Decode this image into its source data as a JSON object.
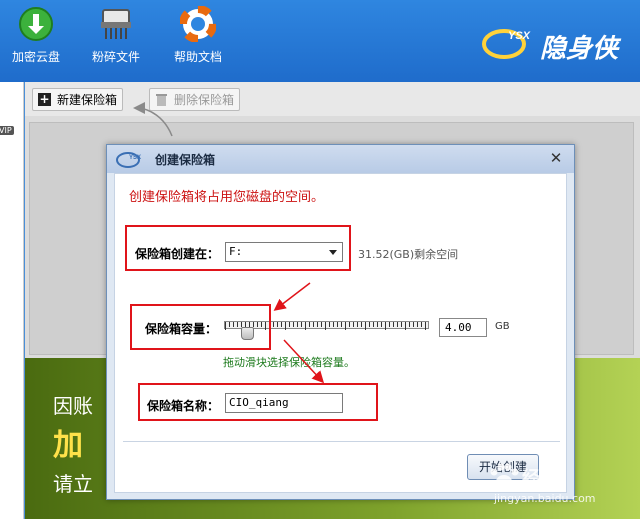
{
  "toolbar": {
    "tools": [
      {
        "label": "加密云盘",
        "icon": "cloud-icon"
      },
      {
        "label": "粉碎文件",
        "icon": "shredder-icon"
      },
      {
        "label": "帮助文档",
        "icon": "lifebuoy-icon"
      }
    ],
    "brand_text": "隐身侠"
  },
  "sidebar": {
    "vip_tag": "VIP"
  },
  "main_toolbar": {
    "new_label": "新建保险箱",
    "delete_label": "删除保险箱"
  },
  "banner": {
    "line1": "因账",
    "line2": "加",
    "line3": "请立"
  },
  "dialog": {
    "title": "创建保险箱",
    "notice": "创建保险箱将占用您磁盘的空间。",
    "location_label": "保险箱创建在：",
    "drive_value": "F:",
    "free_space": "31.52(GB)剩余空间",
    "capacity_label": "保险箱容量：",
    "capacity_value": "4.00",
    "capacity_unit": "GB",
    "slider_hint": "拖动滑块选择保险箱容量。",
    "name_label": "保险箱名称：",
    "name_value": "CIO_qiang",
    "start_button": "开始创建",
    "close_glyph": "✕"
  },
  "watermark": {
    "text": "经验",
    "url": "jingyan.baidu.com"
  },
  "colors": {
    "accent": "#1f6ccb",
    "annotation": "#e0141a",
    "notice": "#cc1111",
    "hint": "#1c7a1c"
  }
}
